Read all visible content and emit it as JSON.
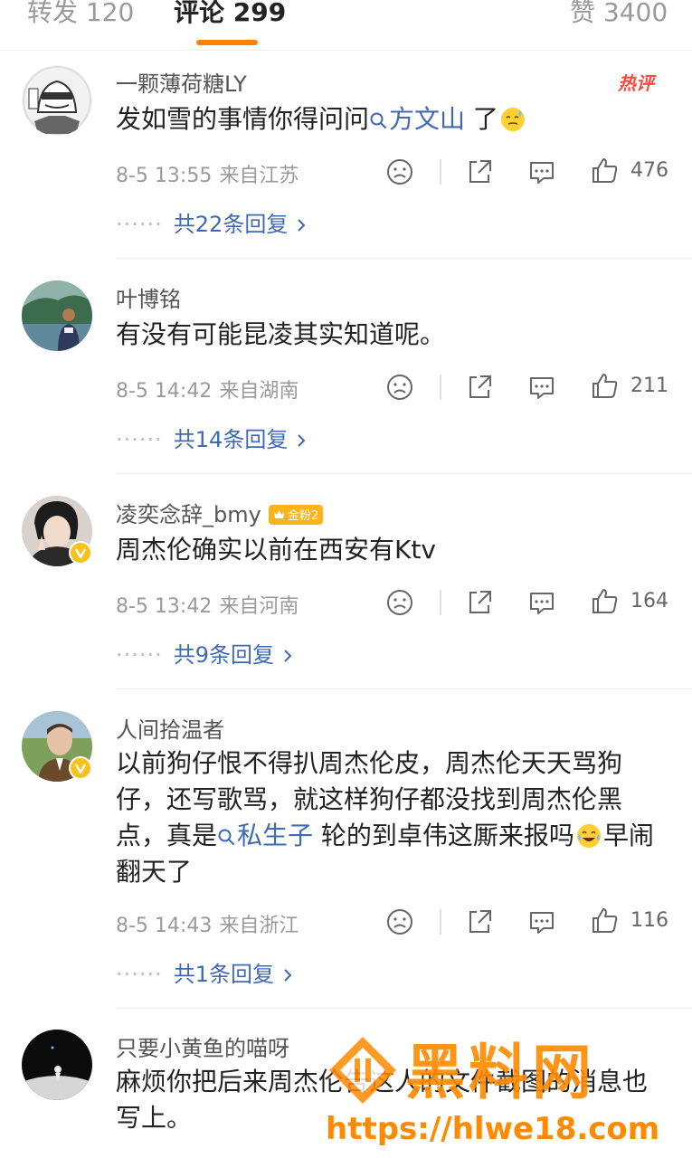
{
  "tabs": {
    "repost": "转发 120",
    "comments": "评论 299",
    "likes": "赞 3400"
  },
  "hot_label": "热评",
  "comments": [
    {
      "username": "一颗薄荷糖LY",
      "text_before": "发如雪的事情你得问问",
      "topic": "方文山",
      "text_after": " 了",
      "emoji": "sweat-emoji",
      "time": "8-5 13:55",
      "location": "来自江苏",
      "likes": "476",
      "replies": "共22条回复"
    },
    {
      "username": "叶博铭",
      "text": "有没有可能昆凌其实知道呢。",
      "time": "8-5 14:42",
      "location": "来自湖南",
      "likes": "211",
      "replies": "共14条回复"
    },
    {
      "username": "凌奕念辞_bmy",
      "badge": "金粉2",
      "text": "周杰伦确实以前在西安有Ktv",
      "time": "8-5 13:42",
      "location": "来自河南",
      "likes": "164",
      "replies": "共9条回复"
    },
    {
      "username": "人间拾温者",
      "text_before": "以前狗仔恨不得扒周杰伦皮，周杰伦天天骂狗仔，还写歌骂，就这样狗仔都没找到周杰伦黑点，真是",
      "topic": "私生子",
      "text_after": " 轮的到卓伟这厮来报吗",
      "emoji": "laugh-cry-emoji",
      "text_end": "早闹翻天了",
      "time": "8-5 14:43",
      "location": "来自浙江",
      "likes": "116",
      "replies": "共1条回复"
    },
    {
      "username": "只要小黄鱼的喵呀",
      "text": "麻烦你把后来周杰伦告这人的文件截图的消息也写上。"
    }
  ],
  "watermark": {
    "text": "黑料网",
    "url": "https://hlwe18.com"
  },
  "colors": {
    "accent": "#ff8200",
    "link": "#3f6ab3",
    "muted": "#9a9a9a"
  }
}
